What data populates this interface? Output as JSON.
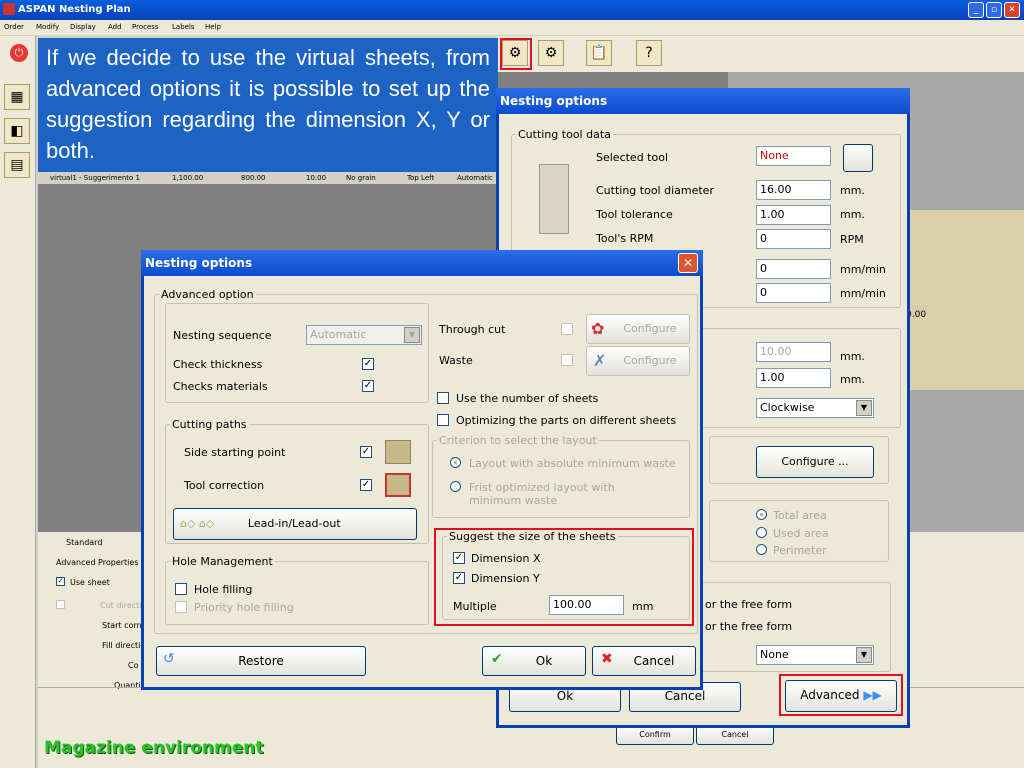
{
  "app": {
    "title": "ASPAN Nesting Plan",
    "window_controls": [
      "_",
      "▫",
      "✕"
    ]
  },
  "menu": [
    "Order",
    "Modify",
    "Display",
    "Add",
    "Process",
    "Labels",
    "Help"
  ],
  "callout": {
    "text": "If we decide to use the virtual sheets, from advanced options it is possible to set up the suggestion regarding the dimension X, Y or both."
  },
  "background": {
    "grid_row": [
      "virtual1 - Suggerimento 1",
      "1,100.00",
      "800.00",
      "10.00",
      "No grain",
      "Top Left",
      "Automatic"
    ],
    "bottom_panel": {
      "tab": "Standard",
      "group": "Advanced Properties",
      "use_sheet": "Use sheet",
      "cut_direction": "Cut directio",
      "start_corner": "Start corne",
      "fill_direction": "Fill directio",
      "co": "Co",
      "quantity": "Quanti"
    },
    "right_value": "0.00",
    "footer_buttons": {
      "confirm": "Confirm",
      "cancel": "Cancel"
    },
    "magazine_label": "Magazine environment",
    "icons": {
      "stop": "stop-icon",
      "nesting": "nesting-options-icon",
      "settings": "settings-icon",
      "report": "report-icon",
      "help": "help-icon"
    }
  },
  "back_dialog": {
    "title": "Nesting options",
    "tool_group": "Cutting tool data",
    "selected_tool": {
      "label": "Selected tool",
      "value": "None"
    },
    "diameter": {
      "label": "Cutting tool diameter",
      "value": "16.00",
      "unit": "mm."
    },
    "tolerance": {
      "label": "Tool tolerance",
      "value": "1.00",
      "unit": "mm."
    },
    "rpm": {
      "label": "Tool's RPM",
      "value": "0",
      "unit": "RPM"
    },
    "speed1": {
      "value": "0",
      "unit": "mm/min"
    },
    "speed2": {
      "value": "0",
      "unit": "mm/min"
    },
    "field3": {
      "value": "10.00",
      "unit": "mm."
    },
    "field4": {
      "value": "1.00",
      "unit": "mm."
    },
    "direction": "Clockwise",
    "configure": "Configure ...",
    "radios": [
      "Total area",
      "Used area",
      "Perimeter"
    ],
    "free_form1": "or the free form",
    "free_form2": "or the free form",
    "none_select": "None",
    "ok": "Ok",
    "cancel": "Cancel",
    "advanced": "Advanced"
  },
  "dialog": {
    "title": "Nesting options",
    "advanced_option": "Advanced option",
    "nesting_sequence": {
      "label": "Nesting sequence",
      "value": "Automatic"
    },
    "check_thickness": "Check thickness",
    "checks_materials": "Checks materials",
    "through_cut": "Through cut",
    "waste": "Waste",
    "configure": "Configure",
    "use_number_sheets": "Use the number of sheets",
    "optimizing_parts": "Optimizing the parts on different sheets",
    "criterion": {
      "legend": "Criterion to select the layout",
      "opt1": "Layout with absolute minimum waste",
      "opt2": "Frist optimized layout with minimum waste"
    },
    "cutting_paths": {
      "legend": "Cutting paths",
      "side_start": "Side starting point",
      "tool_correction": "Tool correction",
      "lead": "Lead-in/Lead-out"
    },
    "suggest": {
      "legend": "Suggest the size of the sheets",
      "dim_x": "Dimension X",
      "dim_y": "Dimension Y",
      "multiple": "Multiple",
      "multiple_value": "100.00",
      "unit": "mm"
    },
    "hole": {
      "legend": "Hole Management",
      "filling": "Hole filling",
      "priority": "Priority hole filling"
    },
    "restore": "Restore",
    "ok": "Ok",
    "cancel": "Cancel",
    "close": "✕"
  }
}
